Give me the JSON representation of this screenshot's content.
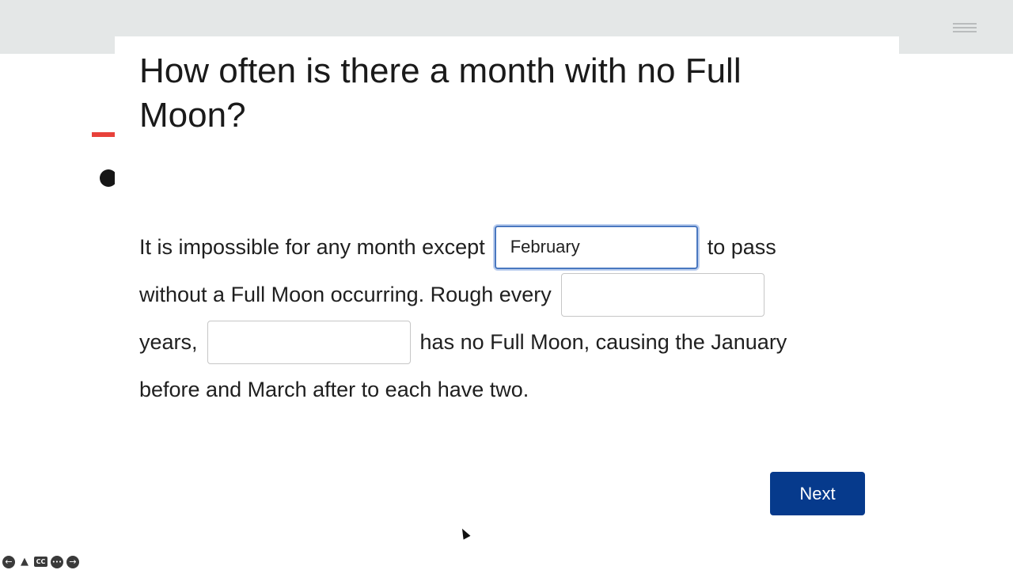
{
  "header": {
    "menu_icon": "hamburger-menu-icon"
  },
  "question": {
    "title": "How often is there a month with no Full Moon?"
  },
  "passage": {
    "line1_before": "It is impossible for any month except",
    "blank1_value": "February",
    "line1_after": "to pass",
    "line2_before": "without a Full Moon occurring. Rough every",
    "blank2_value": "",
    "line3_before": "years,",
    "blank3_value": "",
    "line3_after": "has no Full Moon, causing the January",
    "line4": "before and March after to each have two."
  },
  "actions": {
    "next_label": "Next"
  },
  "player_controls": [
    {
      "icon": "back-arrow-icon",
      "glyph": "←"
    },
    {
      "icon": "audio-level-icon",
      "glyph": "▲"
    },
    {
      "icon": "closed-captions-icon",
      "glyph": "CC"
    },
    {
      "icon": "more-options-icon",
      "glyph": "•••"
    },
    {
      "icon": "forward-arrow-icon",
      "glyph": "→"
    }
  ],
  "colors": {
    "primary_button": "#063a8c",
    "focus_ring": "#4a78c0",
    "accent_red": "#e8413a",
    "top_bar": "#e4e7e7"
  }
}
